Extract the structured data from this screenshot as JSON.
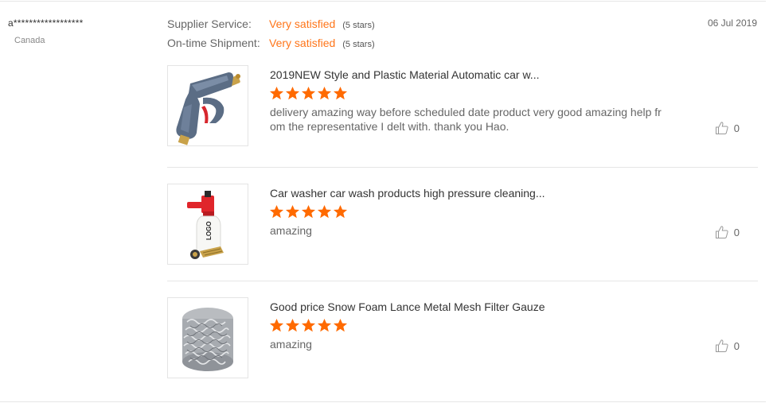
{
  "buyer": {
    "name": "a******************",
    "country": "Canada"
  },
  "date": "06 Jul 2019",
  "ratings": [
    {
      "label": "Supplier Service:",
      "value": "Very satisfied",
      "stars": "(5 stars)"
    },
    {
      "label": "On-time Shipment:",
      "value": "Very satisfied",
      "stars": "(5 stars)"
    }
  ],
  "colors": {
    "accent": "#ff7519",
    "star": "#ff6a00",
    "divider": "#e6e6e6"
  },
  "reviews": [
    {
      "title": "2019NEW Style and Plastic Material Automatic car w...",
      "rating": 5,
      "text": "delivery amazing way before scheduled date product very good amazing help from the representative I delt with. thank you Hao.",
      "likes": "0",
      "image": "spray-gun"
    },
    {
      "title": "Car washer car wash products high pressure cleaning...",
      "rating": 5,
      "text": "amazing",
      "likes": "0",
      "image": "foam-lance-bottle",
      "image_text": "LOGO"
    },
    {
      "title": "Good price Snow Foam Lance Metal Mesh Filter Gauze",
      "rating": 5,
      "text": "amazing",
      "likes": "0",
      "image": "metal-mesh-filter"
    }
  ],
  "icons": {
    "star": "star-icon",
    "like": "thumbs-up-icon"
  }
}
